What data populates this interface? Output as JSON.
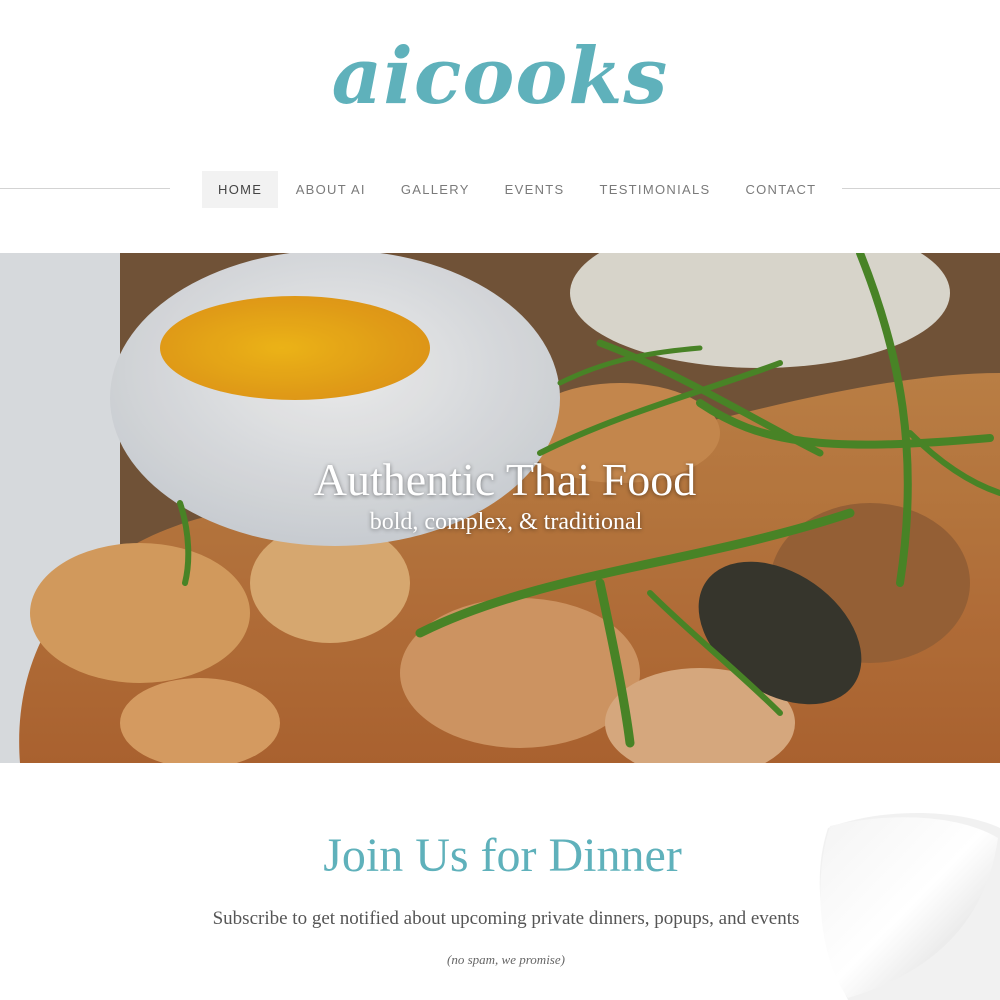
{
  "site": {
    "logo": "aicooks"
  },
  "nav": {
    "items": [
      {
        "label": "HOME",
        "active": true
      },
      {
        "label": "ABOUT AI"
      },
      {
        "label": "GALLERY"
      },
      {
        "label": "EVENTS"
      },
      {
        "label": "TESTIMONIALS"
      },
      {
        "label": "CONTACT"
      }
    ]
  },
  "hero": {
    "title": "Authentic Thai Food",
    "subtitle": "bold, complex, & traditional"
  },
  "join": {
    "title": "Join Us for Dinner",
    "text": "Subscribe to get notified about upcoming private dinners, popups, and events",
    "note": "(no spam, we promise)"
  },
  "colors": {
    "accent": "#5fb1bb",
    "nav_text": "#7a7a7a",
    "nav_active_bg": "#f2f2f2",
    "body_text": "#555555"
  }
}
